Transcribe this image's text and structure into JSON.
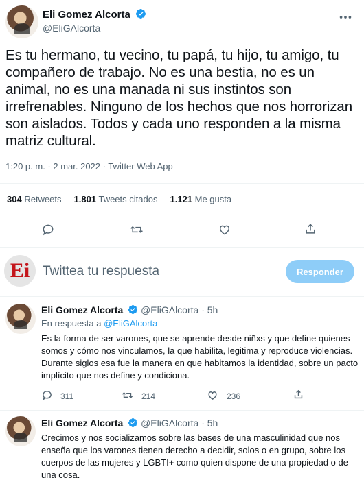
{
  "main_tweet": {
    "author_name": "Eli Gomez Alcorta",
    "author_handle": "@EliGAlcorta",
    "text": "Es tu hermano, tu vecino, tu papá, tu hijo, tu amigo, tu compañero de trabajo. No es una bestia, no es un animal, no es una manada ni sus instintos son irrefrenables. Ninguno de los hechos que nos horrorizan son aislados. Todos y cada uno responden a la misma matriz cultural.",
    "timestamp": "1:20 p. m. · 2 mar. 2022 · Twitter Web App",
    "stats": [
      {
        "value": "304",
        "label": "Retweets"
      },
      {
        "value": "1.801",
        "label": "Tweets citados"
      },
      {
        "value": "1.121",
        "label": "Me gusta"
      }
    ],
    "more_icon": "more-icon"
  },
  "compose": {
    "logo_text": "Ei",
    "placeholder": "Twittea tu respuesta",
    "button_label": "Responder"
  },
  "replies": [
    {
      "author_name": "Eli Gomez Alcorta",
      "author_handle": "@EliGAlcorta",
      "time": "· 5h",
      "reply_prefix": "En respuesta a",
      "reply_to": "@EliGAlcorta",
      "text": "Es la forma de ser varones, que se aprende desde niñxs y que define quienes somos y cómo nos vinculamos, la que habilita, legitima y reproduce violencias. Durante siglos esa fue la manera en que habitamos la identidad, sobre un pacto implícito que nos define y condiciona.",
      "reply_count": "311",
      "retweet_count": "214",
      "like_count": "236"
    },
    {
      "author_name": "Eli Gomez Alcorta",
      "author_handle": "@EliGAlcorta",
      "time": "· 5h",
      "text": "Crecimos y nos socializamos sobre las bases de una masculinidad que nos enseña que los varones tienen derecho a decidir, solos o en grupo, sobre los cuerpos de las mujeres y LGBTI+ como quien dispone de una propiedad o de una cosa."
    }
  ],
  "colors": {
    "accent": "#1d9bf0",
    "button_disabled": "#8ecdf8",
    "text_primary": "#0f1419",
    "text_secondary": "#536471",
    "divider": "#eff3f4",
    "brand_red": "#c4151b"
  }
}
